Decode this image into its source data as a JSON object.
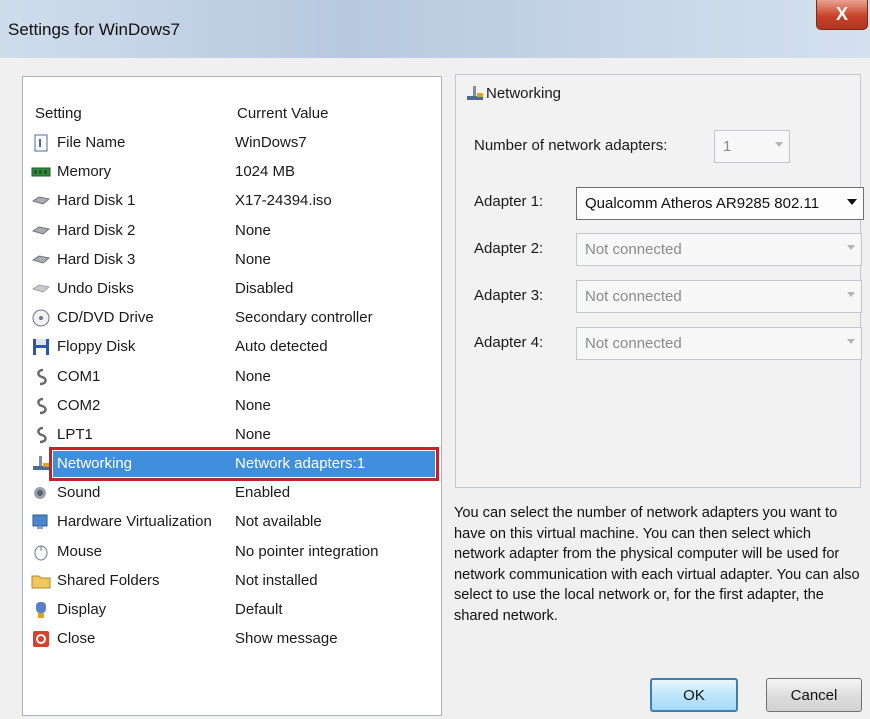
{
  "window": {
    "title": "Settings for WinDows7",
    "close_label": "X"
  },
  "list": {
    "header_setting": "Setting",
    "header_value": "Current Value",
    "items": [
      {
        "name": "File Name",
        "value": "WinDows7",
        "icon": "file-icon"
      },
      {
        "name": "Memory",
        "value": "1024 MB",
        "icon": "memory-icon"
      },
      {
        "name": "Hard Disk 1",
        "value": "X17-24394.iso",
        "icon": "hard-disk-icon"
      },
      {
        "name": "Hard Disk 2",
        "value": "None",
        "icon": "hard-disk-icon"
      },
      {
        "name": "Hard Disk 3",
        "value": "None",
        "icon": "hard-disk-icon"
      },
      {
        "name": "Undo Disks",
        "value": "Disabled",
        "icon": "undo-disk-icon"
      },
      {
        "name": "CD/DVD Drive",
        "value": "Secondary controller",
        "icon": "cd-dvd-icon"
      },
      {
        "name": "Floppy Disk",
        "value": "Auto detected",
        "icon": "floppy-icon"
      },
      {
        "name": "COM1",
        "value": "None",
        "icon": "port-icon"
      },
      {
        "name": "COM2",
        "value": "None",
        "icon": "port-icon"
      },
      {
        "name": "LPT1",
        "value": "None",
        "icon": "port-icon"
      },
      {
        "name": "Networking",
        "value": "Network adapters:1",
        "icon": "network-icon",
        "selected": true
      },
      {
        "name": "Sound",
        "value": "Enabled",
        "icon": "sound-icon"
      },
      {
        "name": "Hardware Virtualization",
        "value": "Not available",
        "icon": "hardware-virtualization-icon"
      },
      {
        "name": "Mouse",
        "value": "No pointer integration",
        "icon": "mouse-icon"
      },
      {
        "name": "Shared Folders",
        "value": "Not installed",
        "icon": "folder-icon"
      },
      {
        "name": "Display",
        "value": "Default",
        "icon": "display-icon"
      },
      {
        "name": "Close",
        "value": "Show message",
        "icon": "close-setting-icon"
      }
    ]
  },
  "networking": {
    "title": "Networking",
    "num_adapters_label": "Number of network adapters:",
    "num_adapters_value": "1",
    "adapters": [
      {
        "label": "Adapter 1:",
        "value": "Qualcomm Atheros AR9285 802.11"
      },
      {
        "label": "Adapter 2:",
        "value": "Not connected"
      },
      {
        "label": "Adapter 3:",
        "value": "Not connected"
      },
      {
        "label": "Adapter 4:",
        "value": "Not connected"
      }
    ],
    "help_text": "You can select the number of network adapters you want to have on this virtual machine. You can then select which network adapter from the physical computer will be used for network communication with each virtual adapter. You can also select to use the local network or, for the first adapter, the shared network."
  },
  "buttons": {
    "ok": "OK",
    "cancel": "Cancel"
  },
  "colors": {
    "selection": "#3f8fdc",
    "highlight_border": "#c0232b"
  }
}
